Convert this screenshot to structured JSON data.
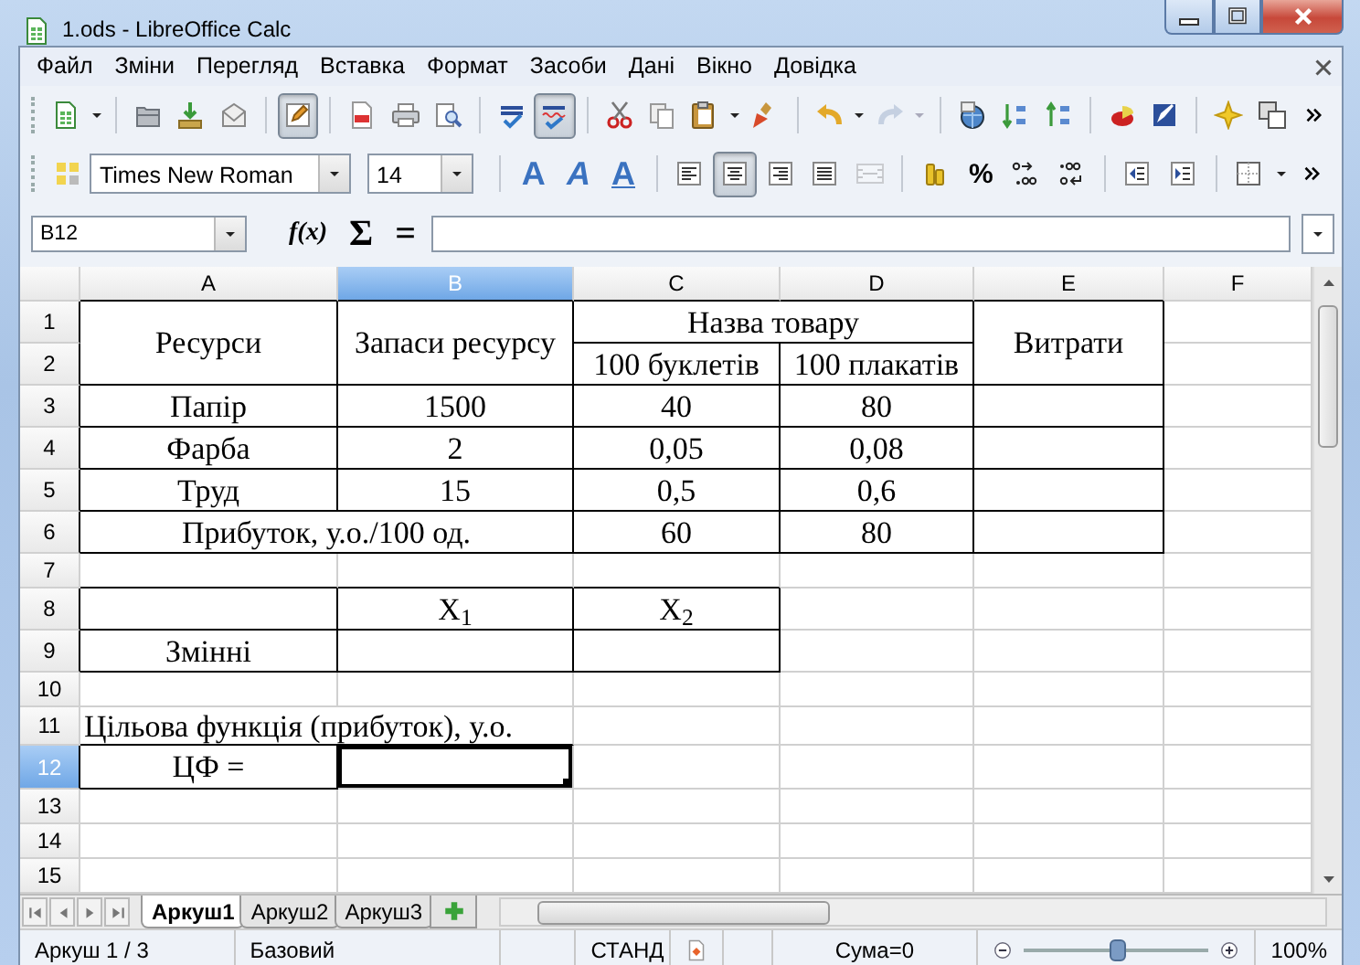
{
  "window": {
    "title": "1.ods - LibreOffice Calc"
  },
  "menu": [
    "Файл",
    "Зміни",
    "Перегляд",
    "Вставка",
    "Формат",
    "Засоби",
    "Дані",
    "Вікно",
    "Довідка"
  ],
  "standard_toolbar": {
    "buttons": [
      {
        "selected": false,
        "disabled": false
      },
      {
        "selected": false,
        "disabled": false
      },
      {
        "selected": false,
        "disabled": false
      },
      {
        "selected": false,
        "disabled": false
      },
      {
        "selected": true,
        "disabled": false
      },
      {
        "selected": false,
        "disabled": false
      },
      {
        "selected": false,
        "disabled": false
      },
      {
        "selected": false,
        "disabled": false
      },
      {
        "selected": false,
        "disabled": false
      },
      {
        "selected": true,
        "disabled": false
      },
      {
        "selected": false,
        "disabled": false
      },
      {
        "selected": false,
        "disabled": false
      },
      {
        "selected": false,
        "disabled": false
      },
      {
        "selected": false,
        "disabled": false
      },
      {
        "selected": false,
        "disabled": false
      },
      {
        "selected": false,
        "disabled": true
      },
      {
        "selected": false,
        "disabled": false
      },
      {
        "selected": false,
        "disabled": false
      },
      {
        "selected": false,
        "disabled": false
      },
      {
        "selected": false,
        "disabled": false
      },
      {
        "selected": false,
        "disabled": false
      },
      {
        "selected": false,
        "disabled": false
      },
      {
        "selected": false,
        "disabled": false
      }
    ]
  },
  "formatting_toolbar": {
    "font_name": "Times New Roman",
    "font_size": "14",
    "buttons": [
      {
        "selected": false,
        "disabled": false
      },
      {
        "label": "A",
        "selected": false,
        "disabled": false
      },
      {
        "label": "A",
        "selected": false,
        "disabled": false
      },
      {
        "label": "A",
        "selected": false,
        "disabled": false
      },
      {
        "selected": false,
        "disabled": false
      },
      {
        "selected": true,
        "disabled": false
      },
      {
        "selected": false,
        "disabled": false
      },
      {
        "selected": false,
        "disabled": false
      },
      {
        "selected": false,
        "disabled": true
      },
      {
        "selected": false,
        "disabled": false
      },
      {
        "label": "%",
        "selected": false,
        "disabled": false
      },
      {
        "selected": false,
        "disabled": false
      },
      {
        "selected": false,
        "disabled": false
      },
      {
        "selected": false,
        "disabled": false
      },
      {
        "selected": false,
        "disabled": false
      },
      {
        "selected": false,
        "disabled": false
      }
    ]
  },
  "formula_bar": {
    "name_box": "B12",
    "function_wizard": "f(x)",
    "sum": "Σ",
    "equals": "="
  },
  "sheet": {
    "columns": [
      {
        "label": "A",
        "selected": false
      },
      {
        "label": "B",
        "selected": true
      },
      {
        "label": "C",
        "selected": false
      },
      {
        "label": "D",
        "selected": false
      },
      {
        "label": "E",
        "selected": false
      },
      {
        "label": "F",
        "selected": false
      }
    ],
    "rows": [
      {
        "number": "1",
        "selected": false,
        "cells": [
          {
            "text": "Ресурси",
            "rowspan": 2
          },
          {
            "text": "Запаси ресурсу",
            "rowspan": 2
          },
          {
            "text": "Назва товару",
            "colspan": 2
          },
          {
            "text": "Витрати",
            "rowspan": 2
          }
        ]
      },
      {
        "number": "2",
        "selected": false,
        "cells": [
          "100 буклетів",
          "100 плакатів"
        ]
      },
      {
        "number": "3",
        "selected": false,
        "cells": [
          "Папір",
          "1500",
          "40",
          "80"
        ]
      },
      {
        "number": "4",
        "selected": false,
        "cells": [
          "Фарба",
          "2",
          "0,05",
          "0,08"
        ]
      },
      {
        "number": "5",
        "selected": false,
        "cells": [
          "Труд",
          "15",
          "0,5",
          "0,6"
        ]
      },
      {
        "number": "6",
        "selected": false,
        "cells": [
          {
            "text": "Прибуток, у.о./100 од.",
            "colspan": 2
          },
          "60",
          "80"
        ]
      },
      {
        "number": "7",
        "selected": false,
        "cells": []
      },
      {
        "number": "8",
        "selected": false,
        "cells": [
          "",
          "X$_{1}$",
          "X$_{2}$"
        ]
      },
      {
        "number": "9",
        "selected": false,
        "cells": [
          "Змінні"
        ]
      },
      {
        "number": "10",
        "selected": false,
        "cells": []
      },
      {
        "number": "11",
        "selected": false,
        "cells": [
          {
            "text": "Цільова функція (прибуток), у.о.",
            "colspan": 2
          }
        ]
      },
      {
        "number": "12",
        "selected": true,
        "cells": [
          "ЦФ ="
        ]
      },
      {
        "number": "13",
        "selected": false,
        "cells": []
      },
      {
        "number": "14",
        "selected": false,
        "cells": []
      },
      {
        "number": "15",
        "selected": false,
        "cells": []
      }
    ]
  },
  "sheet_tabs": [
    {
      "label": "Аркуш1",
      "selected": true
    },
    {
      "label": "Аркуш2",
      "selected": false
    },
    {
      "label": "Аркуш3",
      "selected": false
    }
  ],
  "status_bar": {
    "sheet": "Аркуш 1 / 3",
    "page_style": "Базовий",
    "mode": "СТАНД",
    "sum": "Сума=0",
    "zoom": {
      "level": 0.5,
      "reading": "100%"
    }
  }
}
